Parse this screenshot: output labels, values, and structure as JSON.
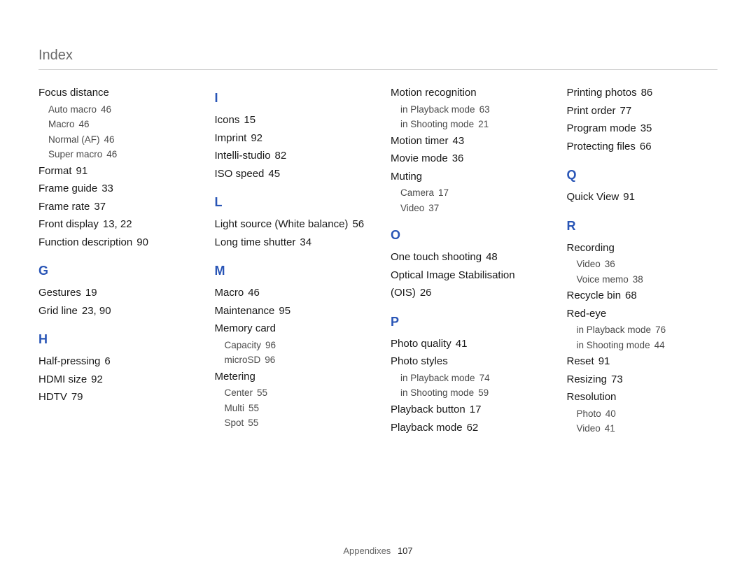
{
  "header": {
    "title": "Index"
  },
  "footer": {
    "section": "Appendixes",
    "page": "107"
  },
  "columns": [
    {
      "groups": [
        {
          "entries": [
            {
              "t": "Focus distance",
              "subs": [
                {
                  "t": "Auto macro",
                  "p": "46"
                },
                {
                  "t": "Macro",
                  "p": "46"
                },
                {
                  "t": "Normal (AF)",
                  "p": "46"
                },
                {
                  "t": "Super macro",
                  "p": "46"
                }
              ]
            },
            {
              "t": "Format",
              "p": "91"
            },
            {
              "t": "Frame guide",
              "p": "33"
            },
            {
              "t": "Frame rate",
              "p": "37"
            },
            {
              "t": "Front display",
              "p": "13, 22"
            },
            {
              "t": "Function description",
              "p": "90"
            }
          ]
        },
        {
          "letter": "G",
          "entries": [
            {
              "t": "Gestures",
              "p": "19"
            },
            {
              "t": "Grid line",
              "p": "23, 90"
            }
          ]
        },
        {
          "letter": "H",
          "entries": [
            {
              "t": "Half-pressing",
              "p": "6"
            },
            {
              "t": "HDMI size",
              "p": "92"
            },
            {
              "t": "HDTV",
              "p": "79"
            }
          ]
        }
      ]
    },
    {
      "groups": [
        {
          "letter": "I",
          "first": true,
          "entries": [
            {
              "t": "Icons",
              "p": "15"
            },
            {
              "t": "Imprint",
              "p": "92"
            },
            {
              "t": "Intelli-studio",
              "p": "82"
            },
            {
              "t": "ISO speed",
              "p": "45"
            }
          ]
        },
        {
          "letter": "L",
          "entries": [
            {
              "t": "Light source (White balance)",
              "p": "56"
            },
            {
              "t": "Long time shutter",
              "p": "34"
            }
          ]
        },
        {
          "letter": "M",
          "entries": [
            {
              "t": "Macro",
              "p": "46"
            },
            {
              "t": "Maintenance",
              "p": "95"
            },
            {
              "t": "Memory card",
              "subs": [
                {
                  "t": "Capacity",
                  "p": "96"
                },
                {
                  "t": "microSD",
                  "p": "96"
                }
              ]
            },
            {
              "t": "Metering",
              "subs": [
                {
                  "t": "Center",
                  "p": "55"
                },
                {
                  "t": "Multi",
                  "p": "55"
                },
                {
                  "t": "Spot",
                  "p": "55"
                }
              ]
            }
          ]
        }
      ]
    },
    {
      "groups": [
        {
          "entries": [
            {
              "t": "Motion recognition",
              "subs": [
                {
                  "t": "in Playback mode",
                  "p": "63"
                },
                {
                  "t": "in Shooting mode",
                  "p": "21"
                }
              ]
            },
            {
              "t": "Motion timer",
              "p": "43"
            },
            {
              "t": "Movie mode",
              "p": "36"
            },
            {
              "t": "Muting",
              "subs": [
                {
                  "t": "Camera",
                  "p": "17"
                },
                {
                  "t": "Video",
                  "p": "37"
                }
              ]
            }
          ]
        },
        {
          "letter": "O",
          "entries": [
            {
              "t": "One touch shooting",
              "p": "48"
            },
            {
              "t": "Optical Image Stabilisation (OIS)",
              "p": "26"
            }
          ]
        },
        {
          "letter": "P",
          "entries": [
            {
              "t": "Photo quality",
              "p": "41"
            },
            {
              "t": "Photo styles",
              "subs": [
                {
                  "t": "in Playback mode",
                  "p": "74"
                },
                {
                  "t": "in Shooting mode",
                  "p": "59"
                }
              ]
            },
            {
              "t": "Playback button",
              "p": "17"
            },
            {
              "t": "Playback mode",
              "p": "62"
            }
          ]
        }
      ]
    },
    {
      "groups": [
        {
          "entries": [
            {
              "t": "Printing photos",
              "p": "86"
            },
            {
              "t": "Print order",
              "p": "77"
            },
            {
              "t": "Program mode",
              "p": "35"
            },
            {
              "t": "Protecting files",
              "p": "66"
            }
          ]
        },
        {
          "letter": "Q",
          "entries": [
            {
              "t": "Quick View",
              "p": "91"
            }
          ]
        },
        {
          "letter": "R",
          "entries": [
            {
              "t": "Recording",
              "subs": [
                {
                  "t": "Video",
                  "p": "36"
                },
                {
                  "t": "Voice memo",
                  "p": "38"
                }
              ]
            },
            {
              "t": "Recycle bin",
              "p": "68"
            },
            {
              "t": "Red-eye",
              "subs": [
                {
                  "t": "in Playback mode",
                  "p": "76"
                },
                {
                  "t": "in Shooting mode",
                  "p": "44"
                }
              ]
            },
            {
              "t": "Reset",
              "p": "91"
            },
            {
              "t": "Resizing",
              "p": "73"
            },
            {
              "t": "Resolution",
              "subs": [
                {
                  "t": "Photo",
                  "p": "40"
                },
                {
                  "t": "Video",
                  "p": "41"
                }
              ]
            }
          ]
        }
      ]
    }
  ]
}
